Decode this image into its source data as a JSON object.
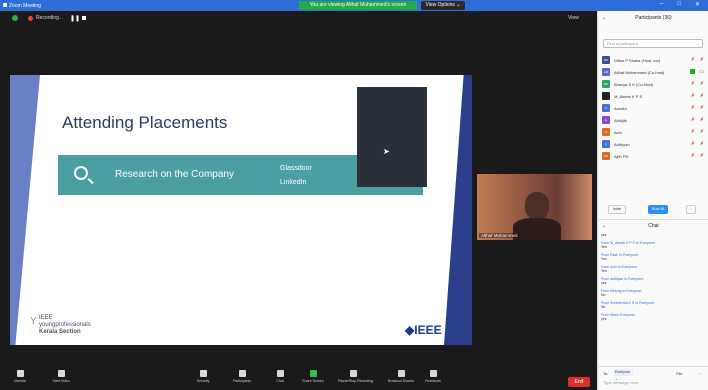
{
  "window": {
    "title": "Zoom Meeting",
    "controls": [
      "–",
      "□",
      "✕"
    ]
  },
  "share_banner": "You are viewing Althaf Muhammed's screen",
  "view_options": "View Options ⌄",
  "topbar": {
    "recording_label": "Recording...",
    "view_label": "View"
  },
  "slide": {
    "title": "Attending Placements",
    "box_text": "Research on the Company",
    "links": [
      "Glassdoor",
      "LinkedIn"
    ],
    "yp_small": "IEEE",
    "yp_brand": "youngprofessionals",
    "yp_section": "Kerala Section",
    "ieee_logo": "◆IEEE"
  },
  "webcam": {
    "name": "Althaf Muhammed"
  },
  "toolbar": {
    "items": [
      {
        "label": "Unmute",
        "color": "#d8d8d8"
      },
      {
        "label": "Start Video",
        "color": "#d8d8d8"
      },
      {
        "label": "Security",
        "color": "#d8d8d8"
      },
      {
        "label": "Participants",
        "color": "#d8d8d8"
      },
      {
        "label": "Chat",
        "color": "#d8d8d8"
      },
      {
        "label": "Share Screen",
        "color": "#2fbf4a"
      },
      {
        "label": "Pause/Stop Recording",
        "color": "#d8d8d8"
      },
      {
        "label": "Breakout Rooms",
        "color": "#d8d8d8"
      },
      {
        "label": "Reactions",
        "color": "#d8d8d8"
      }
    ],
    "end_label": "End"
  },
  "participants": {
    "header": "Participants (36)",
    "search_placeholder": "Find a participant",
    "list": [
      {
        "initials": "DP",
        "name": "Dilkar P Shaka (Host, me)",
        "color": "#3a4e8c",
        "mic": "✗",
        "cam": "✗"
      },
      {
        "initials": "AM",
        "name": "Althaf Muhammed (Co-host)",
        "color": "#5a6ad0",
        "mic": "",
        "cam": ""
      },
      {
        "initials": "BS",
        "name": "Bhavya S K (Co-Host)",
        "color": "#2aa86a",
        "mic": "✗",
        "cam": "✗"
      },
      {
        "initials": "",
        "name": "M_Akeeb K P S",
        "color": "#222222",
        "mic": "✗",
        "cam": "✗"
      },
      {
        "initials": "A",
        "name": "Aarathi",
        "color": "#4a6fd8",
        "mic": "✗",
        "cam": "✗"
      },
      {
        "initials": "A",
        "name": "Abhijith",
        "color": "#8a4ad0",
        "mic": "✗",
        "cam": "✗"
      },
      {
        "initials": "A",
        "name": "Achi",
        "color": "#e06a2a",
        "mic": "✗",
        "cam": "✗"
      },
      {
        "initials": "A",
        "name": "Adithyan",
        "color": "#4a6fd8",
        "mic": "✗",
        "cam": "✗"
      },
      {
        "initials": "AP",
        "name": "Ajith PD",
        "color": "#e06a2a",
        "mic": "✗",
        "cam": "✗"
      }
    ],
    "invite": "Invite",
    "mute_all": "Mute All",
    "more": "..."
  },
  "chat": {
    "header": "Chat",
    "messages": [
      {
        "from": "",
        "text": "yes"
      },
      {
        "from": "From M_Akeeb K P S to Everyone:",
        "text": "Yes"
      },
      {
        "from": "From Rach to Everyone:",
        "text": "Yes"
      },
      {
        "from": "From Achi to Everyone:",
        "text": "Yes"
      },
      {
        "from": "From adithyan to Everyone:",
        "text": "yes"
      },
      {
        "from": "From Mesnig to Everyone:",
        "text": "No"
      },
      {
        "from": "From Sreedevika K S to Everyone:",
        "text": "No"
      },
      {
        "from": "From Manu Everyone:",
        "text": "yes"
      }
    ],
    "to_label": "To:",
    "recipient": "Everyone ⌄",
    "file_label": "File",
    "more": "...",
    "placeholder": "Type message here..."
  }
}
